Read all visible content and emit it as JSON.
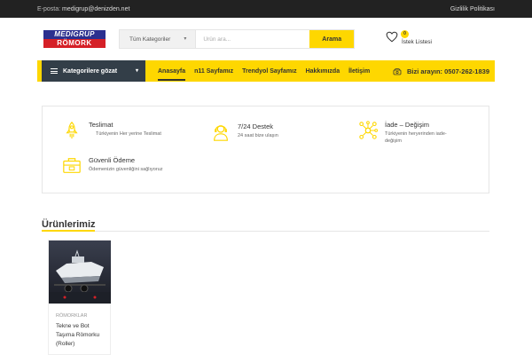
{
  "topbar": {
    "email_label": "E-posta:",
    "email": "medigrup@denizden.net",
    "privacy": "Gizlilik Politikası"
  },
  "logo": {
    "line1": "MEDIGRUP",
    "line2": "RÖMORK"
  },
  "search": {
    "category": "Tüm Kategoriler",
    "placeholder": "Ürün ara...",
    "value": "",
    "button": "Arama"
  },
  "wishlist": {
    "count": "0",
    "label": "İstek Listesi"
  },
  "nav": {
    "browse": "Kategorilere gözat",
    "items": [
      {
        "label": "Anasayfa",
        "active": true
      },
      {
        "label": "n11 Sayfamız"
      },
      {
        "label": "Trendyol Sayfamız"
      },
      {
        "label": "Hakkımızda"
      },
      {
        "label": "İletişim"
      }
    ],
    "phone": "Bizi arayın: 0507-262-1839"
  },
  "features": [
    {
      "icon": "rocket-icon",
      "title": "Teslimat",
      "desc": "Türkiyenin Her yerine Teslimat"
    },
    {
      "icon": "support-agent-icon",
      "title": "7/24 Destek",
      "desc": "24 saat bize ulaşın"
    },
    {
      "icon": "network-exchange-icon",
      "title": "İade – Değişim",
      "desc": "Türkiyenin heryerinden iade-değişim"
    },
    {
      "icon": "secure-payment-icon",
      "title": "Güvenli Ödeme",
      "desc": "Ödemenizin güvenliğini sağlıyoruz"
    }
  ],
  "products_section": {
    "title": "Ürünlerimiz",
    "items": [
      {
        "category": "RÖMORKLAR",
        "name": "Tekne ve Bot Taşıma Römorku (Roller)"
      }
    ]
  },
  "colors": {
    "accent": "#fed700",
    "dark": "#333e48",
    "topbar": "#222222"
  }
}
